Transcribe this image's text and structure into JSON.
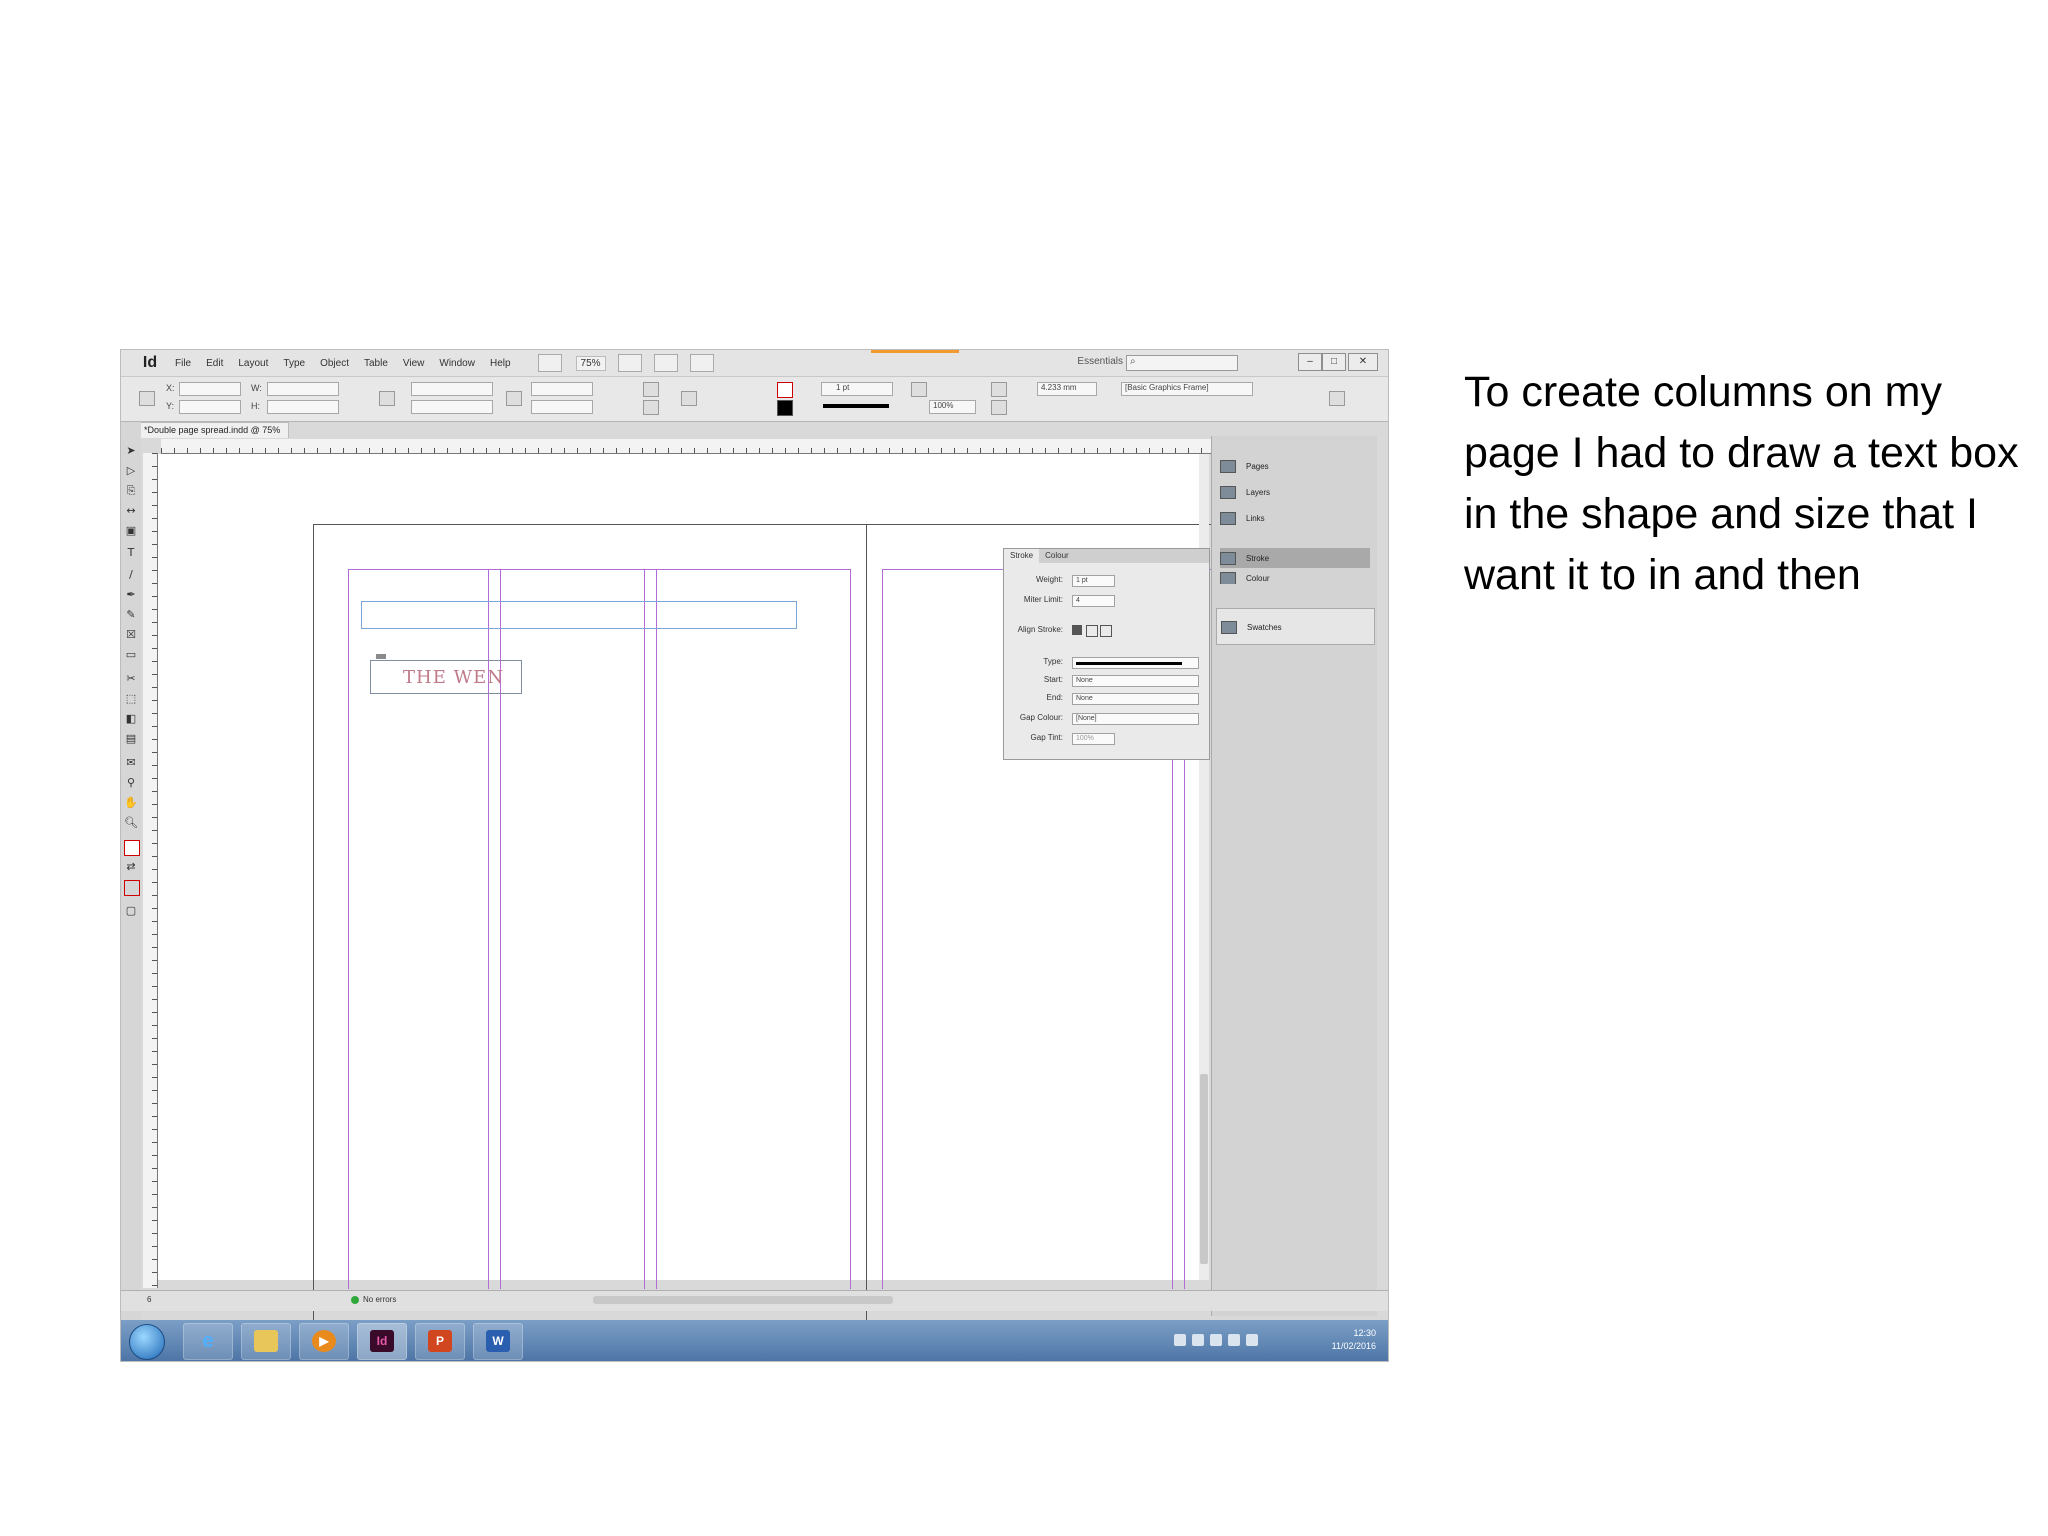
{
  "caption": "To create columns on my page I had to draw a text box in the shape and size that I want it to in and then",
  "app": {
    "logo": "Id",
    "menus": [
      "File",
      "Edit",
      "Layout",
      "Type",
      "Object",
      "Table",
      "View",
      "Window",
      "Help"
    ],
    "zoom": "75%",
    "workspace": "Essentials",
    "search_placeholder": "",
    "window_buttons": [
      "–",
      "□",
      "✕"
    ]
  },
  "control_bar": {
    "x_label": "X:",
    "y_label": "Y:",
    "w_label": "W:",
    "h_label": "H:",
    "stroke_weight": "1 pt",
    "opacity": "100%",
    "frame_style": "[Basic Graphics Frame]",
    "size_value": "4.233 mm"
  },
  "document_tab": "*Double page spread.indd @ 75%",
  "canvas": {
    "title_text": "THE WEN"
  },
  "stroke_panel": {
    "tabs": [
      "Stroke",
      "Colour"
    ],
    "rows": [
      {
        "label": "Weight:",
        "value": "1 pt"
      },
      {
        "label": "Miter Limit:",
        "value": "4"
      },
      {
        "label": "Align Stroke:",
        "value": ""
      },
      {
        "label": "Type:",
        "value": ""
      },
      {
        "label": "Start:",
        "value": "None"
      },
      {
        "label": "End:",
        "value": "None"
      },
      {
        "label": "Gap Colour:",
        "value": "[None]"
      },
      {
        "label": "Gap Tint:",
        "value": "100%"
      }
    ]
  },
  "right_dock": {
    "items": [
      "Pages",
      "Layers",
      "Links",
      "Stroke",
      "Colour",
      "Swatches"
    ]
  },
  "status_bar": {
    "page": "6",
    "preflight": "No errors"
  },
  "taskbar": {
    "time": "12:30",
    "date": "11/02/2016"
  },
  "colors": {
    "guide": "#b26ad9",
    "frame": "#7aa6d6",
    "taskbar": "#4d75a6",
    "indesign": "#3a0a2a"
  }
}
